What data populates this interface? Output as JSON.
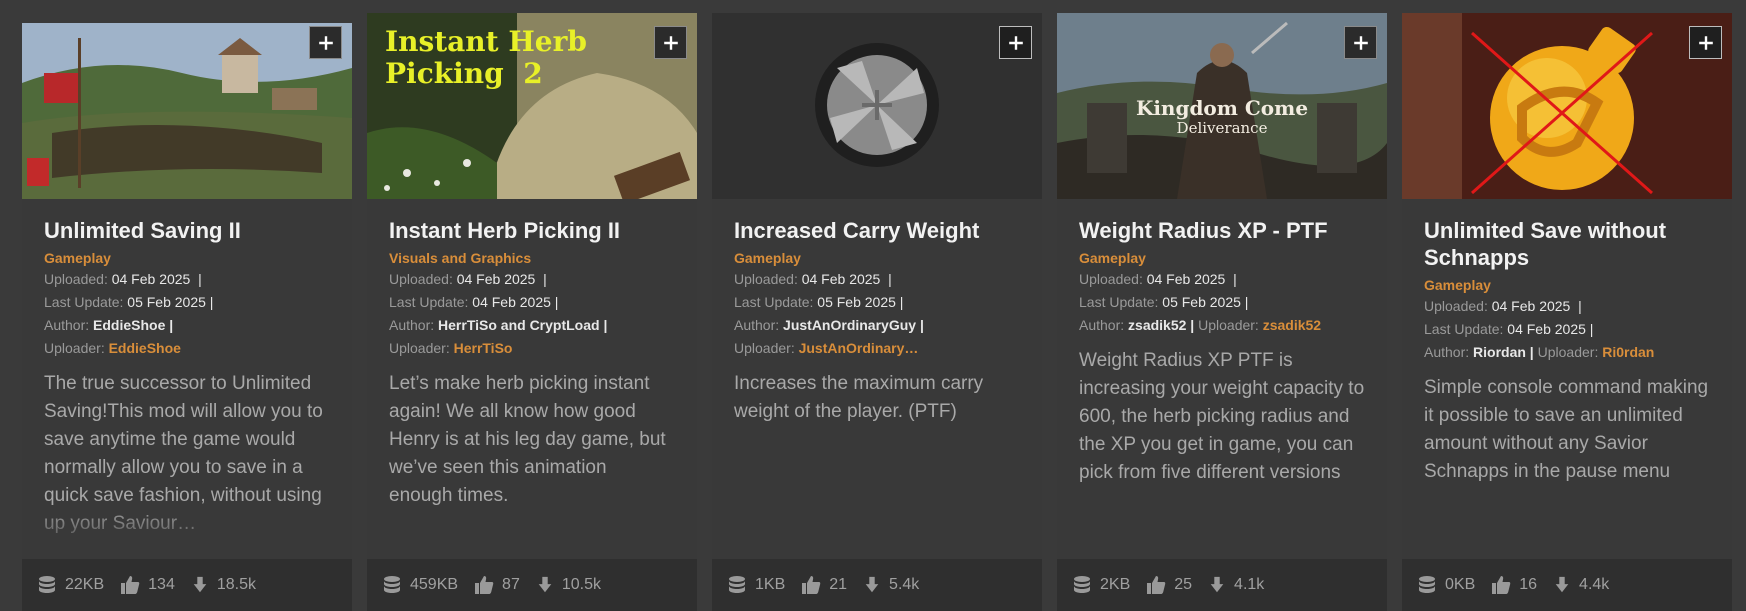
{
  "cards": [
    {
      "title": "Unlimited Saving II",
      "category": "Gameplay",
      "uploaded_label": "Uploaded:",
      "uploaded": "04 Feb 2025",
      "updated_label": "Last Update:",
      "updated": "05 Feb 2025",
      "author_label": "Author:",
      "author": "EddieShoe",
      "uploader_label": "Uploader:",
      "uploader": "EddieShoe",
      "description": "The true successor to Unlimited Saving!This mod will allow you to save anytime the game would normally allow you to save in a quick save fashion, without using up your Saviour…",
      "size": "22KB",
      "endorsements": "134",
      "downloads": "18.5k"
    },
    {
      "title": "Instant Herb Picking II",
      "thumb_text": "Instant Herb Picking 2",
      "category": "Visuals and Graphics",
      "uploaded_label": "Uploaded:",
      "uploaded": "04 Feb 2025",
      "updated_label": "Last Update:",
      "updated": "04 Feb 2025",
      "author_label": "Author:",
      "author": "HerrTiSo and CryptLoad",
      "uploader_label": "Uploader:",
      "uploader": "HerrTiSo",
      "description": "Let’s make herb picking instant again! We all know how good Henry is at his leg day game, but we’ve seen this animation enough times.",
      "size": "459KB",
      "endorsements": "87",
      "downloads": "10.5k"
    },
    {
      "title": "Increased Carry Weight",
      "category": "Gameplay",
      "uploaded_label": "Uploaded:",
      "uploaded": "04 Feb 2025",
      "updated_label": "Last Update:",
      "updated": "05 Feb 2025",
      "author_label": "Author:",
      "author": "JustAnOrdinaryGuy",
      "uploader_label": "Uploader:",
      "uploader": "JustAnOrdinary…",
      "description": "Increases the maximum carry weight of the player. (PTF)",
      "size": "1KB",
      "endorsements": "21",
      "downloads": "5.4k"
    },
    {
      "title": "Weight Radius XP - PTF",
      "thumb_text_1": "Kingdom Come",
      "thumb_text_2": "Deliverance",
      "category": "Gameplay",
      "uploaded_label": "Uploaded:",
      "uploaded": "04 Feb 2025",
      "updated_label": "Last Update:",
      "updated": "05 Feb 2025",
      "author_label": "Author:",
      "author": "zsadik52",
      "uploader_label": "Uploader:",
      "uploader": "zsadik52",
      "description": "Weight Radius XP PTF is increasing your weight capacity to 600, the herb picking radius and the XP you get in game, you can pick from five different versions",
      "size": "2KB",
      "endorsements": "25",
      "downloads": "4.1k"
    },
    {
      "title": "Unlimited Save without Schnapps",
      "category": "Gameplay",
      "uploaded_label": "Uploaded:",
      "uploaded": "04 Feb 2025",
      "updated_label": "Last Update:",
      "updated": "04 Feb 2025",
      "author_label": "Author:",
      "author": "Riordan",
      "uploader_label": "Uploader:",
      "uploader": "Ri0rdan",
      "description": "Simple console command making it possible to save an unlimited amount without any Savior Schnapps in the pause menu",
      "size": "0KB",
      "endorsements": "16",
      "downloads": "4.4k"
    }
  ],
  "colors": {
    "accent": "#d98e3a",
    "card_bg": "#393939",
    "footer_bg": "#2f2f2f"
  },
  "icons": {
    "add": "plus-icon",
    "size": "database-icon",
    "endorsements": "thumbs-up-icon",
    "downloads": "download-arrow-icon"
  }
}
